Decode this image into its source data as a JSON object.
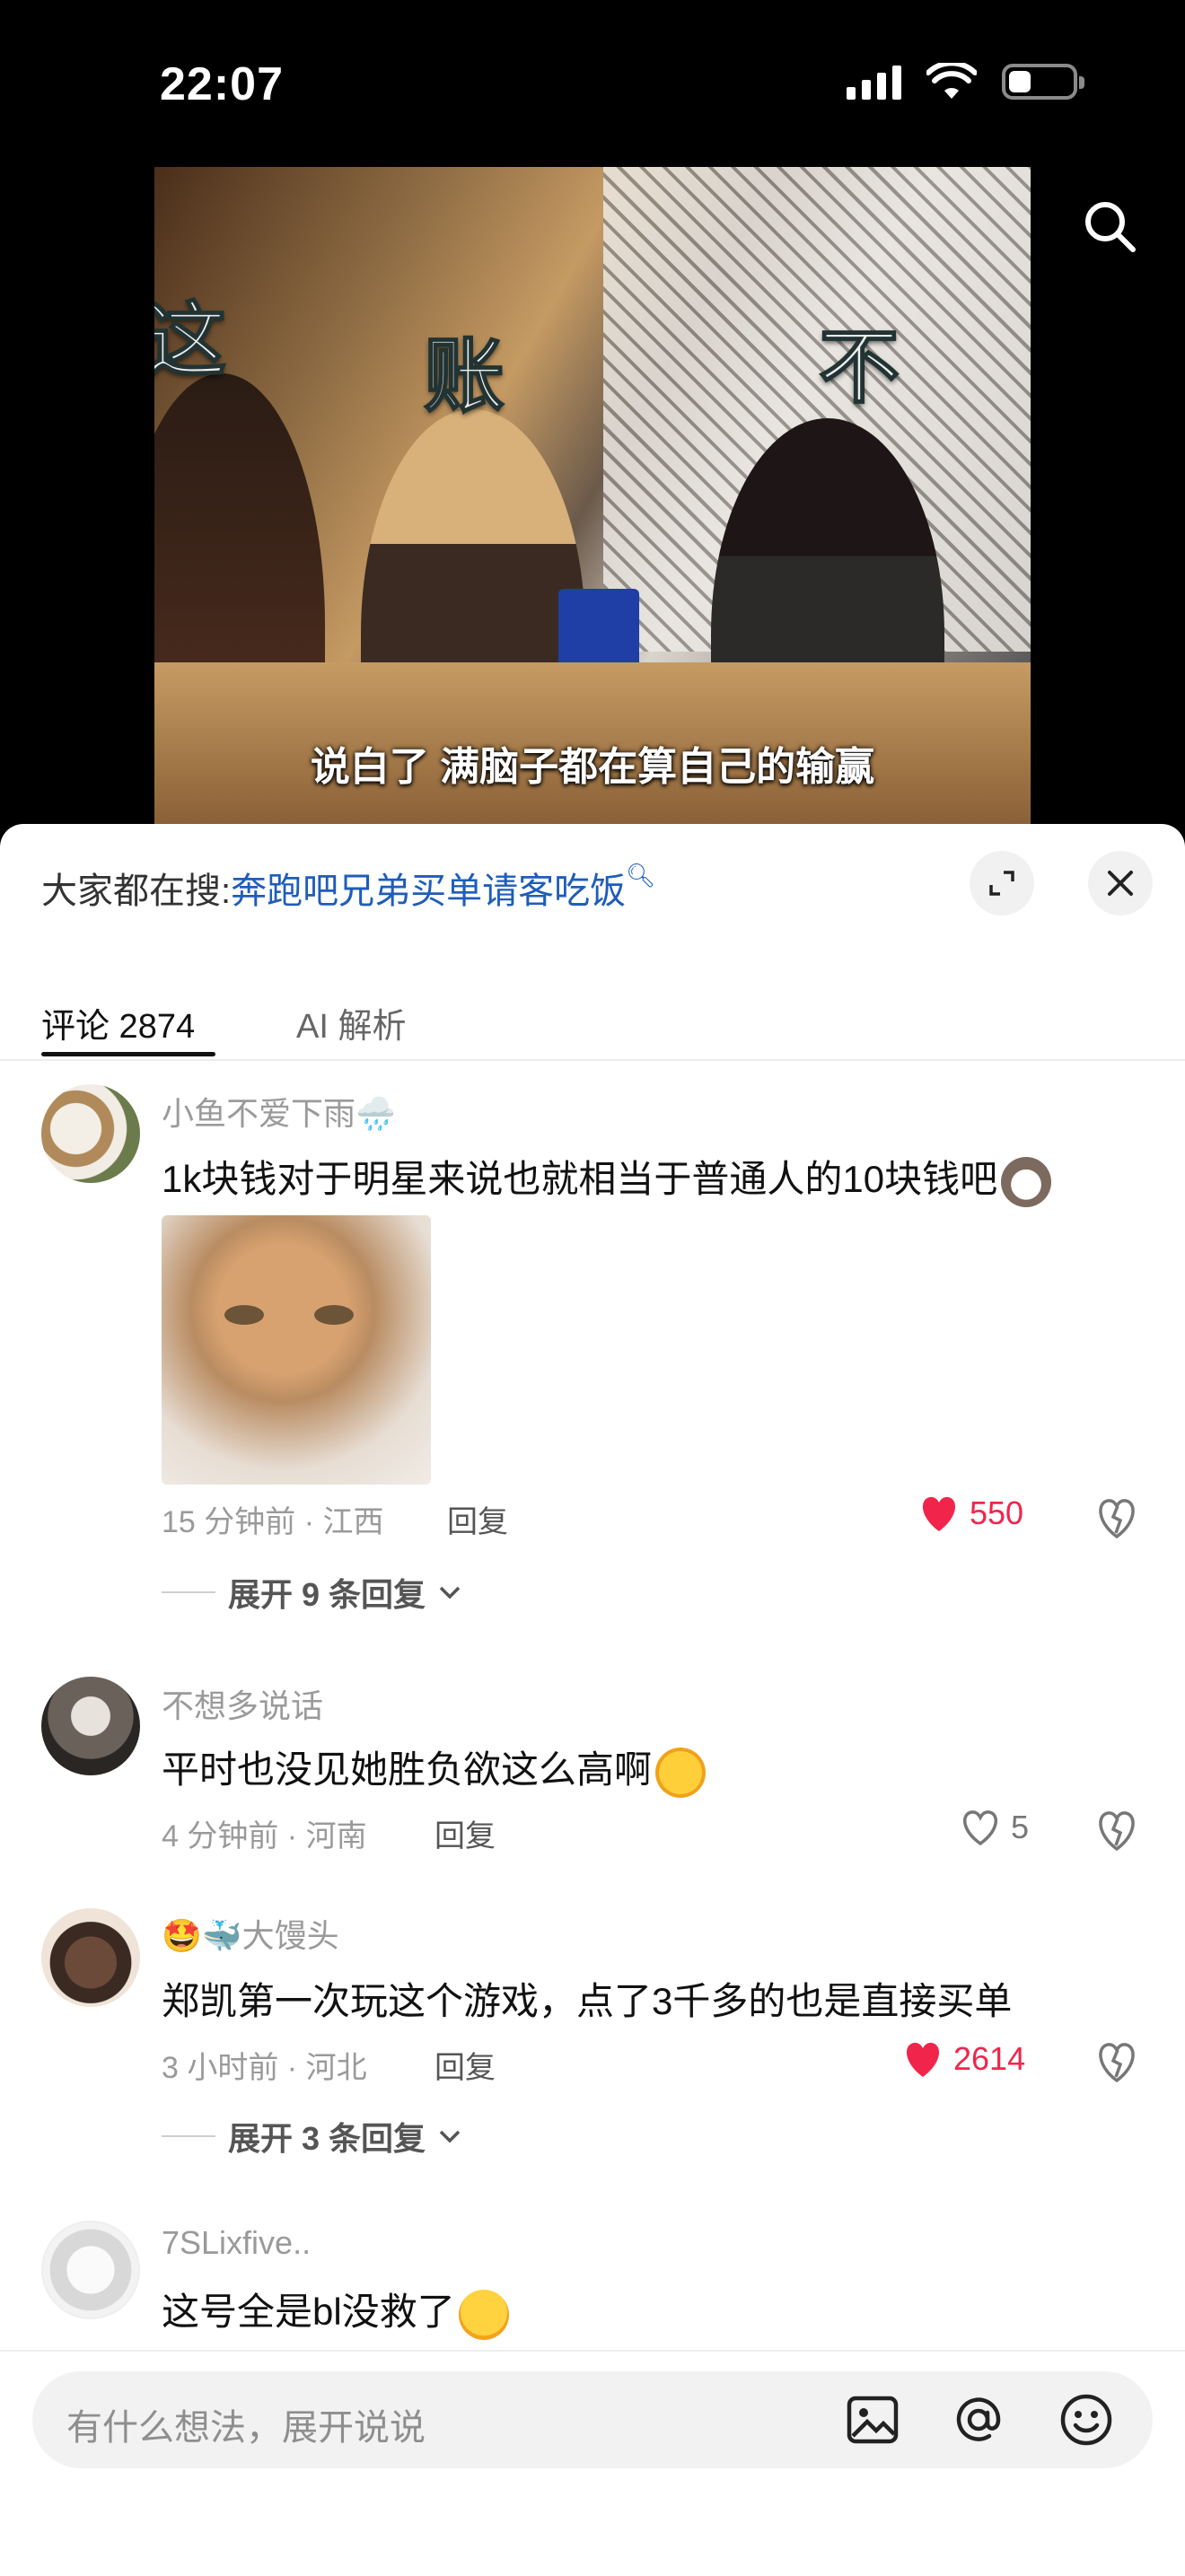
{
  "status": {
    "time": "22:07"
  },
  "video": {
    "subtitle": "说白了 满脑子都在算自己的输赢",
    "overlay_chars": [
      "这",
      "账",
      "不"
    ]
  },
  "sheet": {
    "hot_search_prefix": "大家都在搜:",
    "hot_search_keyword": "奔跑吧兄弟买单请客吃饭",
    "tabs": [
      {
        "label": "评论 2874"
      },
      {
        "label": "AI 解析"
      }
    ]
  },
  "comments": [
    {
      "username": "小鱼不爱下雨🌧️",
      "text": "1k块钱对于明星来说也就相当于普通人的10块钱吧",
      "meta": "15 分钟前 · 江西",
      "reply": "回复",
      "likes": "550",
      "expand": "展开 9 条回复"
    },
    {
      "username": "不想多说话",
      "text": "平时也没见她胜负欲这么高啊",
      "meta": "4 分钟前 · 河南",
      "reply": "回复",
      "likes": "5"
    },
    {
      "username_emoji": "🤩🐳",
      "username": "大馒头",
      "text": "郑凯第一次玩这个游戏，点了3千多的也是直接买单",
      "meta": "3 小时前 · 河北",
      "reply": "回复",
      "likes": "2614",
      "expand": "展开 3 条回复"
    },
    {
      "username": "7SLixfive..",
      "text": "这号全是bl没救了"
    }
  ],
  "input": {
    "placeholder": "有什么想法，展开说说"
  },
  "colors": {
    "like_red": "#f1254b",
    "link_blue": "#1e5db9"
  }
}
